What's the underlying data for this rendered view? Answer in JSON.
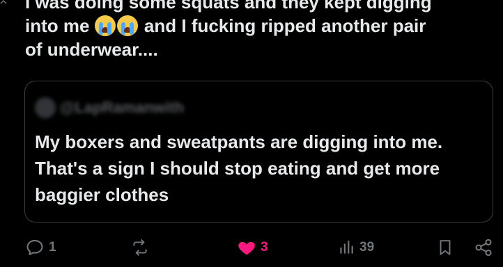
{
  "post": {
    "text_line1": "I was doing some squats and they kept digging",
    "text_line2_a": "into me",
    "text_line2_b": " and I fucking ripped another pair",
    "text_line3": "of underwear....",
    "emojis": [
      "loudly-crying-face-icon",
      "loudly-crying-face-icon"
    ]
  },
  "quote": {
    "handle": "@LapRamanwith",
    "text": "My boxers and sweatpants are digging into me. That's a sign I should stop eating and get more baggier clothes"
  },
  "actions": {
    "reply_count": "1",
    "repost_count": "",
    "like_count": "3",
    "views_count": "39",
    "like_color": "#f91880",
    "muted_color": "#71767b"
  }
}
